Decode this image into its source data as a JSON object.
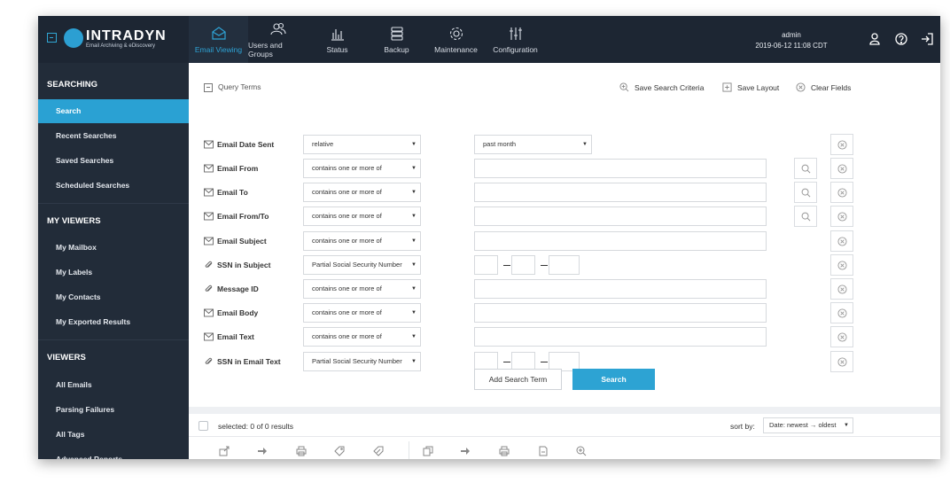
{
  "brand": {
    "title": "INTRADYN",
    "subtitle": "Email Archiving & eDiscovery"
  },
  "nav": [
    {
      "label": "Email Viewing",
      "icon": "envelope-icon",
      "active": true
    },
    {
      "label": "Users and Groups",
      "icon": "users-icon"
    },
    {
      "label": "Status",
      "icon": "bar-chart-icon"
    },
    {
      "label": "Backup",
      "icon": "database-icon"
    },
    {
      "label": "Maintenance",
      "icon": "gear-icon"
    },
    {
      "label": "Configuration",
      "icon": "sliders-icon"
    }
  ],
  "user": {
    "name": "admin",
    "datetime": "2019-06-12 11:08 CDT"
  },
  "sidebar": {
    "sections": [
      {
        "title": "SEARCHING",
        "items": [
          "Search",
          "Recent Searches",
          "Saved Searches",
          "Scheduled Searches"
        ]
      },
      {
        "title": "MY VIEWERS",
        "items": [
          "My Mailbox",
          "My Labels",
          "My Contacts",
          "My Exported Results"
        ]
      },
      {
        "title": "VIEWERS",
        "items": [
          "All Emails",
          "Parsing Failures",
          "All Tags",
          "Advanced Reports"
        ]
      }
    ],
    "active_item": "Search"
  },
  "query": {
    "header": "Query Terms",
    "actions": {
      "save_criteria": "Save Search Criteria",
      "save_layout": "Save Layout",
      "clear_fields": "Clear Fields"
    },
    "rows": [
      {
        "label": "Email Date Sent",
        "icon": "envelope-icon",
        "operator": "relative",
        "value_select": "past month"
      },
      {
        "label": "Email From",
        "icon": "envelope-icon",
        "operator": "contains one or more of",
        "lookup": true
      },
      {
        "label": "Email To",
        "icon": "envelope-icon",
        "operator": "contains one or more of",
        "lookup": true
      },
      {
        "label": "Email From/To",
        "icon": "envelope-icon",
        "operator": "contains one or more of",
        "lookup": true
      },
      {
        "label": "Email Subject",
        "icon": "envelope-icon",
        "operator": "contains one or more of"
      },
      {
        "label": "SSN in Subject",
        "icon": "paperclip-icon",
        "operator": "Partial Social Security Number",
        "ssn": true
      },
      {
        "label": "Message ID",
        "icon": "paperclip-icon",
        "operator": "contains one or more of"
      },
      {
        "label": "Email Body",
        "icon": "envelope-icon",
        "operator": "contains one or more of"
      },
      {
        "label": "Email Text",
        "icon": "envelope-icon",
        "operator": "contains one or more of"
      },
      {
        "label": "SSN in Email Text",
        "icon": "paperclip-icon",
        "operator": "Partial Social Security Number",
        "ssn": true
      }
    ],
    "add_term_label": "Add Search Term",
    "search_label": "Search"
  },
  "results": {
    "selected_text": "selected: 0 of 0 results",
    "sort_label": "sort by:",
    "sort_value": "Date: newest → oldest"
  },
  "colors": {
    "accent": "#2da3d3",
    "sidebar": "#222c39",
    "topbar": "#1d2633"
  }
}
